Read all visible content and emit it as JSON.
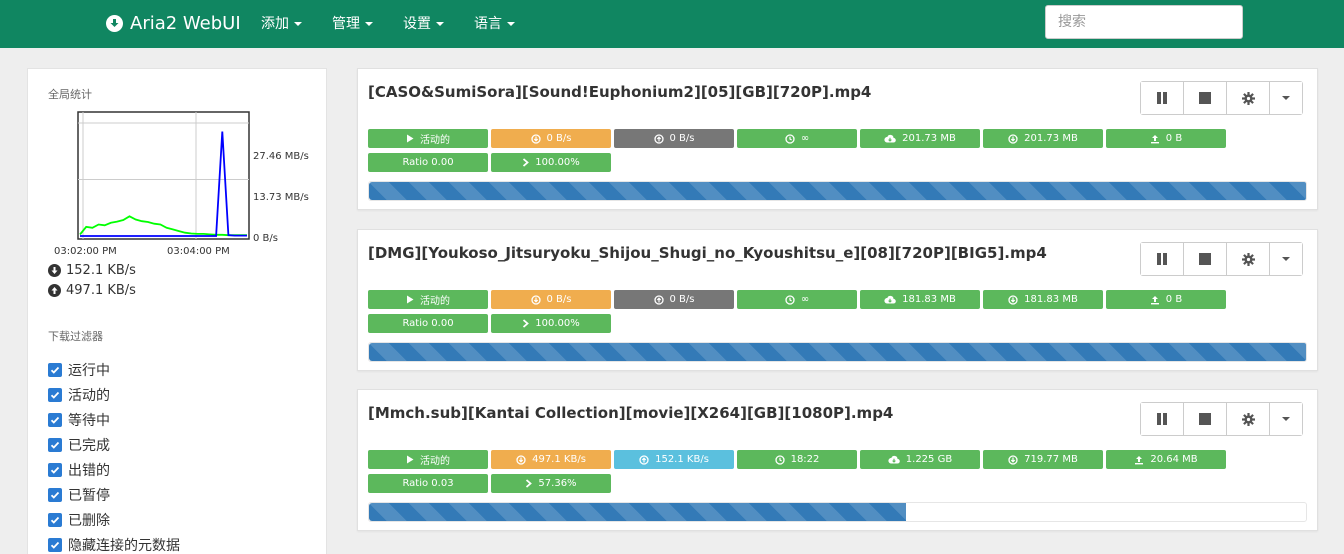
{
  "navbar": {
    "brand": "Aria2 WebUI",
    "menu": [
      "添加",
      "管理",
      "设置",
      "语言"
    ],
    "search_placeholder": "搜索"
  },
  "sidebar": {
    "stats_title": "全局统计",
    "chart": {
      "y_ticks": [
        "27.46 MB/s",
        "13.73 MB/s",
        "0 B/s"
      ],
      "x_ticks": [
        "03:02:00 PM",
        "03:04:00 PM"
      ]
    },
    "download_speed": "152.1 KB/s",
    "upload_speed": "497.1 KB/s",
    "filter_title": "下载过滤器",
    "filters": [
      "运行中",
      "活动的",
      "等待中",
      "已完成",
      "出错的",
      "已暂停",
      "已删除",
      "隐藏连接的元数据"
    ]
  },
  "chart_data": {
    "type": "line",
    "y_ticks": [
      "0 B/s",
      "13.73 MB/s",
      "27.46 MB/s"
    ],
    "x_ticks": [
      "03:02:00 PM",
      "03:04:00 PM"
    ],
    "series": [
      {
        "color": "#00ff00",
        "values": [
          0.4,
          2.2,
          2.0,
          2.8,
          2.6,
          3.2,
          3.5,
          3.9,
          4.8,
          4.0,
          3.6,
          3.4,
          3.0,
          2.8,
          2.0,
          1.6,
          1.2,
          0.8,
          0.6,
          0.5,
          0.5,
          0.4,
          0.3,
          0.3,
          0.2,
          0.2,
          0.2,
          0.2
        ]
      },
      {
        "color": "#0000ff",
        "values": [
          0,
          0,
          0,
          0,
          0,
          0,
          0,
          0,
          0,
          0,
          0,
          0,
          0,
          0,
          0,
          0,
          0,
          0,
          0,
          0,
          0,
          0,
          0,
          25.4,
          0.2,
          0.1,
          0.1,
          0.1
        ]
      }
    ]
  },
  "downloads": [
    {
      "name": "[CASO&SumiSora][Sound!Euphonium2][05][GB][720P].mp4",
      "status": "活动的",
      "down_speed": "0 B/s",
      "up_speed": "0 B/s",
      "eta": "∞",
      "size": "201.73 MB",
      "downloaded": "201.73 MB",
      "uploaded": "0 B",
      "ratio": "Ratio 0.00",
      "percent": "100.00%",
      "progress": 100,
      "up_speed_color": "#777777"
    },
    {
      "name": "[DMG][Youkoso_Jitsuryoku_Shijou_Shugi_no_Kyoushitsu_e][08][720P][BIG5].mp4",
      "status": "活动的",
      "down_speed": "0 B/s",
      "up_speed": "0 B/s",
      "eta": "∞",
      "size": "181.83 MB",
      "downloaded": "181.83 MB",
      "uploaded": "0 B",
      "ratio": "Ratio 0.00",
      "percent": "100.00%",
      "progress": 100,
      "up_speed_color": "#777777"
    },
    {
      "name": "[Mmch.sub][Kantai Collection][movie][X264][GB][1080P].mp4",
      "status": "活动的",
      "down_speed": "497.1 KB/s",
      "up_speed": "152.1 KB/s",
      "eta": "18:22",
      "size": "1.225 GB",
      "downloaded": "719.77 MB",
      "uploaded": "20.64 MB",
      "ratio": "Ratio 0.03",
      "percent": "57.36%",
      "progress": 57.36,
      "up_speed_color": "#5bc0de"
    }
  ]
}
